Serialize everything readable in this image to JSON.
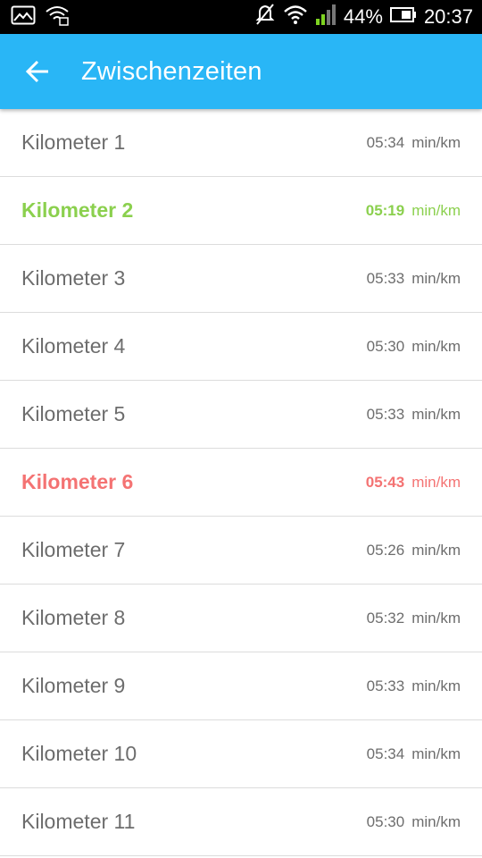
{
  "status_bar": {
    "battery_percent": "44%",
    "time": "20:37",
    "icons": [
      "image-icon",
      "wifi-assist-icon",
      "mute-icon",
      "wifi-icon",
      "signal-icon",
      "battery-icon"
    ]
  },
  "app_bar": {
    "title": "Zwischenzeiten",
    "back_icon": "arrow-left-icon",
    "color": "#29b6f6"
  },
  "colors": {
    "best": "#8bd04e",
    "worst": "#f47373",
    "normal": "#6d6d6d"
  },
  "splits": [
    {
      "label": "Kilometer 1",
      "time": "05:34",
      "unit": "min/km",
      "state": "normal"
    },
    {
      "label": "Kilometer 2",
      "time": "05:19",
      "unit": "min/km",
      "state": "best"
    },
    {
      "label": "Kilometer 3",
      "time": "05:33",
      "unit": "min/km",
      "state": "normal"
    },
    {
      "label": "Kilometer 4",
      "time": "05:30",
      "unit": "min/km",
      "state": "normal"
    },
    {
      "label": "Kilometer 5",
      "time": "05:33",
      "unit": "min/km",
      "state": "normal"
    },
    {
      "label": "Kilometer 6",
      "time": "05:43",
      "unit": "min/km",
      "state": "worst"
    },
    {
      "label": "Kilometer 7",
      "time": "05:26",
      "unit": "min/km",
      "state": "normal"
    },
    {
      "label": "Kilometer 8",
      "time": "05:32",
      "unit": "min/km",
      "state": "normal"
    },
    {
      "label": "Kilometer 9",
      "time": "05:33",
      "unit": "min/km",
      "state": "normal"
    },
    {
      "label": "Kilometer 10",
      "time": "05:34",
      "unit": "min/km",
      "state": "normal"
    },
    {
      "label": "Kilometer 11",
      "time": "05:30",
      "unit": "min/km",
      "state": "normal"
    }
  ]
}
